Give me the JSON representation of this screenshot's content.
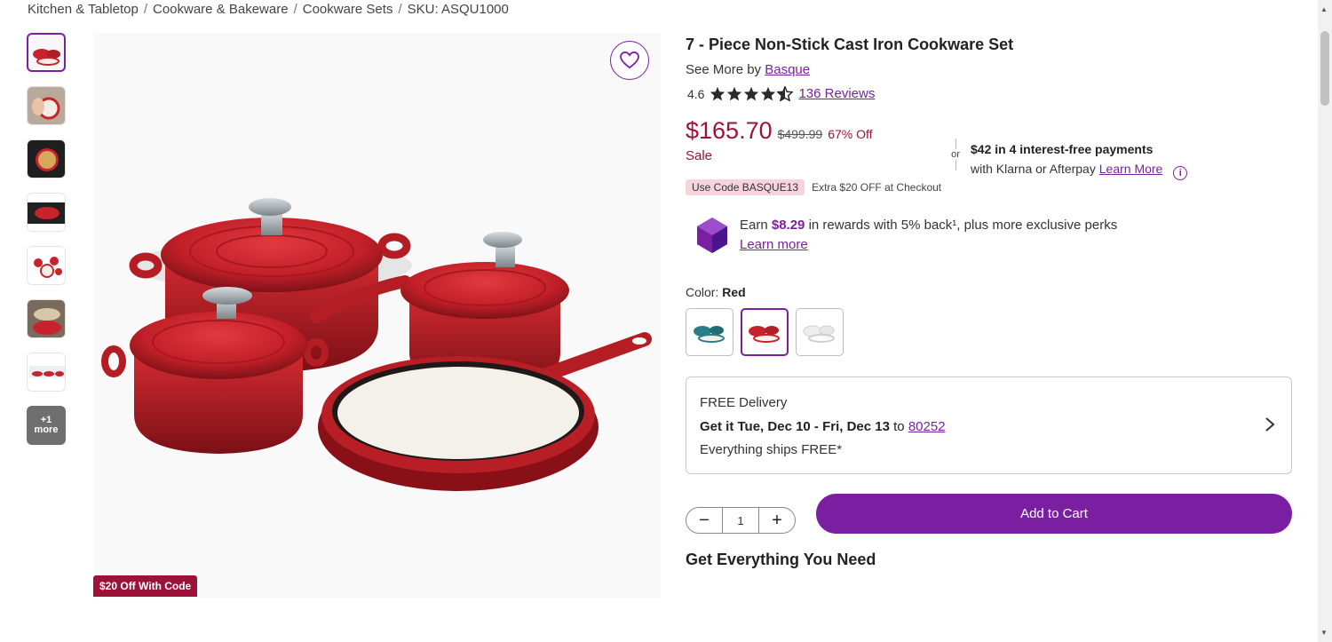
{
  "breadcrumb": {
    "items": [
      "Kitchen & Tabletop",
      "Cookware & Bakeware",
      "Cookware Sets",
      "SKU: ASQU1000"
    ],
    "separator": "/"
  },
  "thumbnails": {
    "more_count": "+1",
    "more_label": "more"
  },
  "main_image": {
    "promo_badge": "$20 Off With Code"
  },
  "product": {
    "title": "7 - Piece Non-Stick Cast Iron Cookware Set",
    "see_more_prefix": "See More by",
    "brand": "Basque",
    "rating": "4.6",
    "reviews": "136 Reviews",
    "price": "$165.70",
    "was_price": "$499.99",
    "discount": "67% Off",
    "sale_label": "Sale"
  },
  "payments": {
    "or": "or",
    "headline": "$42 in 4 interest-free payments",
    "subtext": "with Klarna or Afterpay",
    "learn_more": "Learn More",
    "info": "i"
  },
  "promo_code": {
    "pill": "Use Code BASQUE13",
    "extra": "Extra $20 OFF at Checkout"
  },
  "rewards": {
    "prefix": "Earn",
    "amount": "$8.29",
    "suffix": "in rewards with 5% back¹, plus more exclusive perks",
    "learn_more": "Learn more"
  },
  "color": {
    "label": "Color:",
    "selected": "Red"
  },
  "delivery": {
    "line1": "FREE Delivery",
    "line2_bold": "Get it Tue, Dec 10 - Fri, Dec 13",
    "line2_to": "to",
    "zip": "80252",
    "line3": "Everything ships FREE*"
  },
  "cart": {
    "quantity": "1",
    "minus": "−",
    "plus": "+",
    "add_label": "Add to Cart"
  },
  "section": {
    "get_everything": "Get Everything You Need"
  },
  "colors": {
    "accent": "#7b1fa2",
    "sale": "#9c1238",
    "product_red": "#c8232c"
  }
}
